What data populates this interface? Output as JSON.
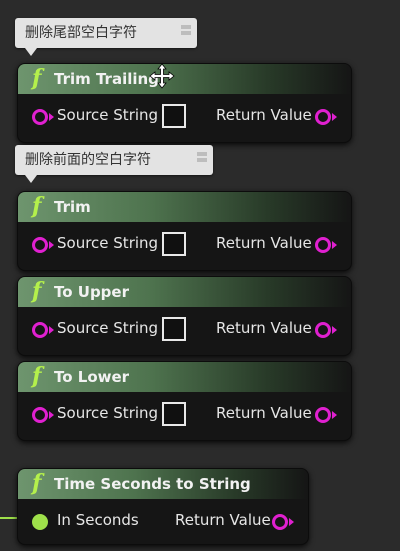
{
  "comments": [
    {
      "text": "删除尾部空白字符"
    },
    {
      "text": "删除前面的空白字符"
    }
  ],
  "nodes": [
    {
      "title": "Trim Trailing",
      "input_label": "Source String",
      "output_label": "Return Value"
    },
    {
      "title": "Trim",
      "input_label": "Source String",
      "output_label": "Return Value"
    },
    {
      "title": "To Upper",
      "input_label": "Source String",
      "output_label": "Return Value"
    },
    {
      "title": "To Lower",
      "input_label": "Source String",
      "output_label": "Return Value"
    },
    {
      "title": "Time Seconds to String",
      "input_label": "In Seconds",
      "output_label": "Return Value"
    }
  ],
  "function_icon": "f",
  "colors": {
    "string_pin": "#e020d0",
    "float_pin": "#9ee04a",
    "header_green": "#6e956e",
    "background": "#2b2b2b"
  },
  "icons": [
    "function-icon",
    "move-cursor-icon",
    "comment-expander-icon"
  ]
}
